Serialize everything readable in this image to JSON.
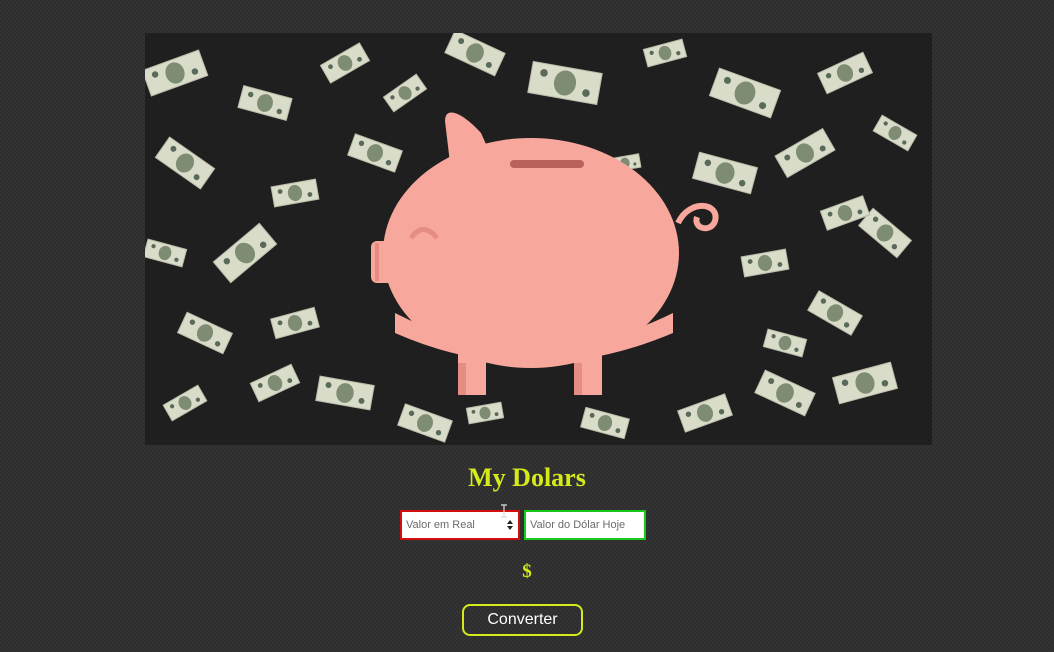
{
  "hero": {
    "image_icon": "piggy-bank-with-falling-dollar-bills",
    "colors": {
      "pig": "#f7a79b",
      "pig_shadow": "#e58d82",
      "slot": "#b8625b",
      "bill": "#d9dcc9",
      "bill_dark": "#7e8c74",
      "background": "#1f1f1f"
    }
  },
  "title": "My Dolars",
  "inputs": {
    "real_placeholder": "Valor em Real",
    "dolar_placeholder": "Valor do Dólar Hoje",
    "real_border_color": "#d40e0e",
    "dolar_border_color": "#19c81c"
  },
  "result": {
    "symbol": "$"
  },
  "button": {
    "label": "Converter",
    "border_color": "#d4ea1a"
  }
}
